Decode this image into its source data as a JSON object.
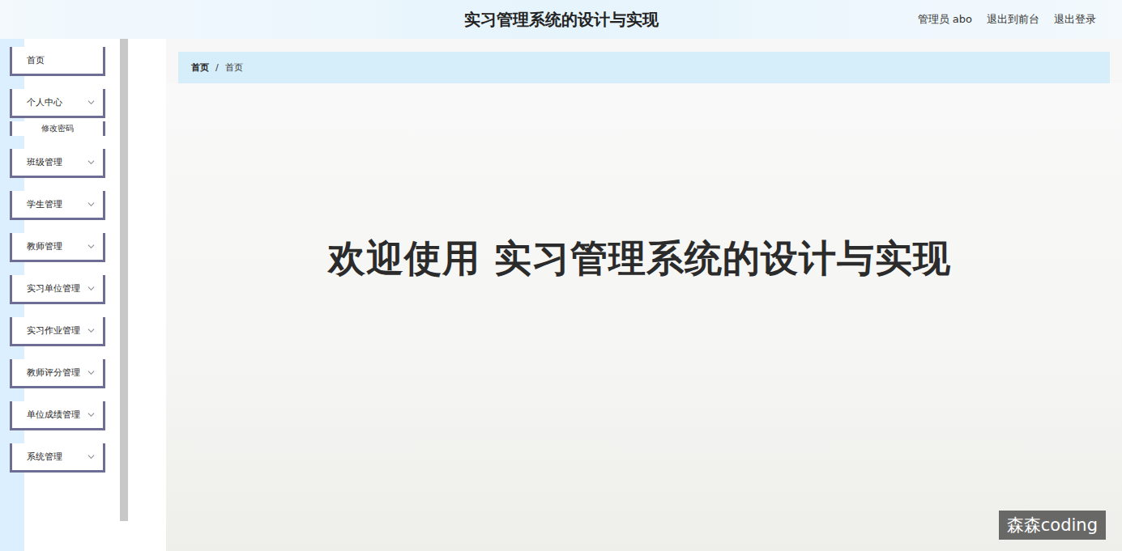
{
  "header": {
    "title": "实习管理系统的设计与实现",
    "user": "管理员 abo",
    "links": [
      "退出到前台",
      "退出登录"
    ]
  },
  "sidebar": {
    "items": [
      {
        "label": "首页",
        "kind": "link",
        "expanded": false,
        "children": []
      },
      {
        "label": "个人中心",
        "kind": "menu",
        "expanded": true,
        "children": [
          "修改密码"
        ]
      },
      {
        "label": "班级管理",
        "kind": "menu",
        "expanded": false,
        "children": []
      },
      {
        "label": "学生管理",
        "kind": "menu",
        "expanded": false,
        "children": []
      },
      {
        "label": "教师管理",
        "kind": "menu",
        "expanded": false,
        "children": []
      },
      {
        "label": "实习单位管理",
        "kind": "menu",
        "expanded": false,
        "children": []
      },
      {
        "label": "实习作业管理",
        "kind": "menu",
        "expanded": false,
        "children": []
      },
      {
        "label": "教师评分管理",
        "kind": "menu",
        "expanded": false,
        "children": []
      },
      {
        "label": "单位成绩管理",
        "kind": "menu",
        "expanded": false,
        "children": []
      },
      {
        "label": "系统管理",
        "kind": "menu",
        "expanded": false,
        "children": []
      }
    ]
  },
  "breadcrumb": {
    "items": [
      "首页",
      "首页"
    ],
    "separator": "/"
  },
  "welcome": {
    "text": "欢迎使用 实习管理系统的设计与实现"
  },
  "watermark": "森森coding"
}
